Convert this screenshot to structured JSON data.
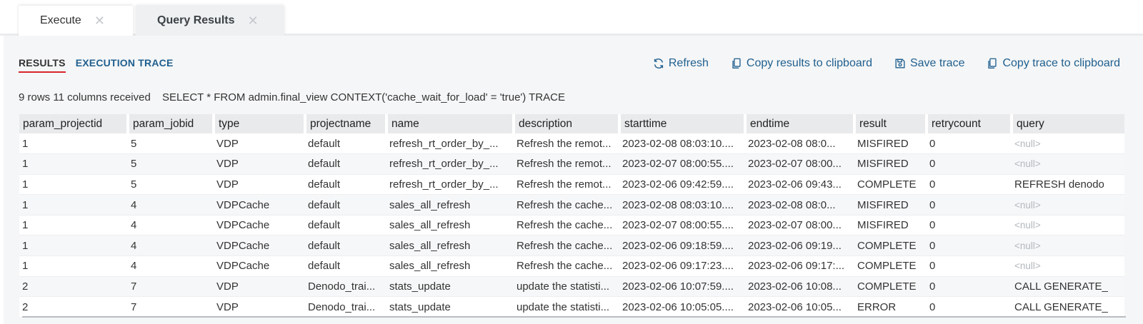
{
  "tabs": [
    {
      "label": "Execute",
      "close": "✕"
    },
    {
      "label": "Query Results",
      "close": "✕"
    }
  ],
  "subtabs": {
    "results": "RESULTS",
    "trace": "EXECUTION TRACE"
  },
  "toolbar": {
    "refresh": "Refresh",
    "copy_results": "Copy results to clipboard",
    "save_trace": "Save trace",
    "copy_trace": "Copy trace to clipboard"
  },
  "status": {
    "summary": "9 rows 11 columns received",
    "query": "SELECT * FROM admin.final_view CONTEXT('cache_wait_for_load' = 'true') TRACE"
  },
  "table": {
    "columns": [
      "param_projectid",
      "param_jobid",
      "type",
      "projectname",
      "name",
      "description",
      "starttime",
      "endtime",
      "result",
      "retrycount",
      "query"
    ],
    "rows": [
      [
        "1",
        "5",
        "VDP",
        "default",
        "refresh_rt_order_by_...",
        "Refresh the remot...",
        "2023-02-08 08:03:10....",
        "2023-02-08 08:0...",
        "MISFIRED",
        "0",
        "<null>"
      ],
      [
        "1",
        "5",
        "VDP",
        "default",
        "refresh_rt_order_by_...",
        "Refresh the remot...",
        "2023-02-07 08:00:55....",
        "2023-02-07 08:00...",
        "MISFIRED",
        "0",
        "<null>"
      ],
      [
        "1",
        "5",
        "VDP",
        "default",
        "refresh_rt_order_by_...",
        "Refresh the remot...",
        "2023-02-06 09:42:59....",
        "2023-02-06 09:43...",
        "COMPLETE",
        "0",
        "REFRESH denodo"
      ],
      [
        "1",
        "4",
        "VDPCache",
        "default",
        "sales_all_refresh",
        "Refresh the cache...",
        "2023-02-08 08:03:10....",
        "2023-02-08 08:0...",
        "MISFIRED",
        "0",
        "<null>"
      ],
      [
        "1",
        "4",
        "VDPCache",
        "default",
        "sales_all_refresh",
        "Refresh the cache...",
        "2023-02-07 08:00:55....",
        "2023-02-07 08:00...",
        "MISFIRED",
        "0",
        "<null>"
      ],
      [
        "1",
        "4",
        "VDPCache",
        "default",
        "sales_all_refresh",
        "Refresh the cache...",
        "2023-02-06 09:18:59....",
        "2023-02-06 09:19...",
        "COMPLETE",
        "0",
        "<null>"
      ],
      [
        "1",
        "4",
        "VDPCache",
        "default",
        "sales_all_refresh",
        "Refresh the cache...",
        "2023-02-06 09:17:23....",
        "2023-02-06 09:17:...",
        "COMPLETE",
        "0",
        "<null>"
      ],
      [
        "2",
        "7",
        "VDP",
        "Denodo_trai...",
        "stats_update",
        "update the statisti...",
        "2023-02-06 10:07:59....",
        "2023-02-06 10:08...",
        "COMPLETE",
        "0",
        "CALL GENERATE_"
      ],
      [
        "2",
        "7",
        "VDP",
        "Denodo_trai...",
        "stats_update",
        "update the statisti...",
        "2023-02-06 10:05:05....",
        "2023-02-06 10:05...",
        "ERROR",
        "0",
        "CALL GENERATE_"
      ]
    ]
  },
  "colors": {
    "accent": "#1f5f8f",
    "active_underline": "#d9262c",
    "null_text": "#b3b8bd"
  },
  "icons": {
    "refresh": "refresh-icon",
    "copy": "copy-icon",
    "save": "save-icon",
    "close": "close-icon"
  }
}
